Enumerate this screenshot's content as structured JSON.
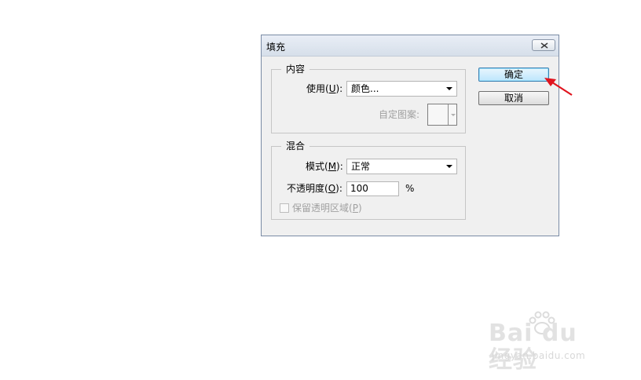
{
  "dialog": {
    "title": "填充",
    "close_icon": "close-icon"
  },
  "content_group": {
    "label": "内容",
    "use_label_pre": "使用(",
    "use_label_key": "U",
    "use_label_post": "):",
    "use_value": "颜色...",
    "custom_pattern_label": "自定图案:"
  },
  "blend_group": {
    "label": "混合",
    "mode_label_pre": "模式(",
    "mode_label_key": "M",
    "mode_label_post": "):",
    "mode_value": "正常",
    "opacity_label_pre": "不透明度(",
    "opacity_label_key": "O",
    "opacity_label_post": "):",
    "opacity_value": "100",
    "opacity_unit": "%",
    "preserve_label_pre": "保留透明区域(",
    "preserve_label_key": "P",
    "preserve_label_post": ")",
    "preserve_checked": false
  },
  "buttons": {
    "ok": "确定",
    "cancel": "取消"
  },
  "annotation": {
    "arrow_color": "#e0141e"
  },
  "watermark": {
    "main": "Bai du 经验",
    "sub": "jingyan.baidu.com"
  }
}
